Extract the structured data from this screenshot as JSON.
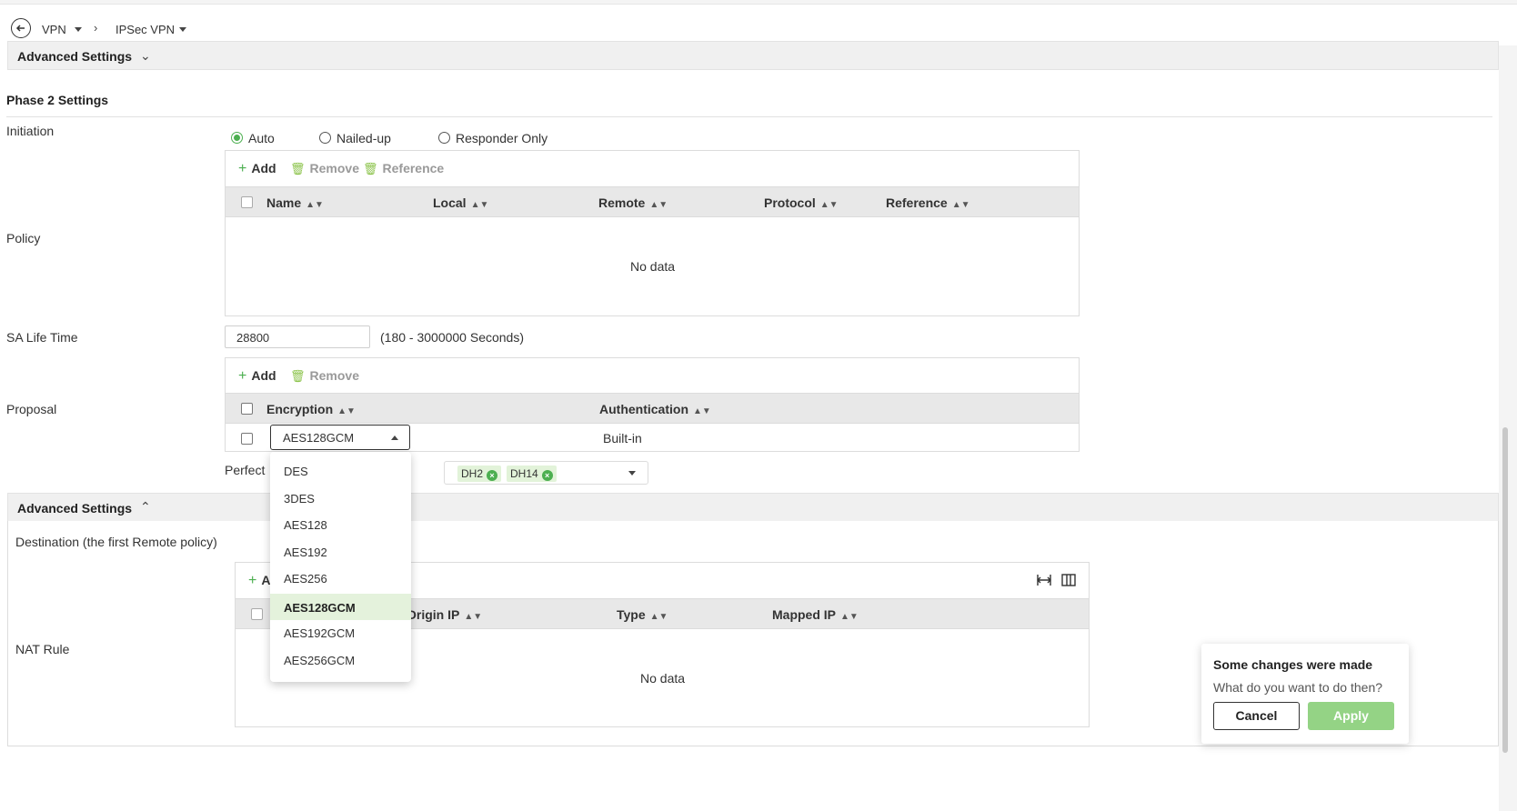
{
  "breadcrumb": {
    "item1": "VPN",
    "item2": "IPSec VPN"
  },
  "advanced_top": {
    "title": "Advanced Settings"
  },
  "phase2": {
    "title": "Phase 2 Settings",
    "initiation_label": "Initiation",
    "initiation_options": [
      "Auto",
      "Nailed-up",
      "Responder Only"
    ],
    "initiation_selected": "Auto",
    "policy_label": "Policy",
    "policy_toolbar": {
      "add": "Add",
      "remove": "Remove",
      "reference": "Reference"
    },
    "policy_columns": [
      "Name",
      "Local",
      "Remote",
      "Protocol",
      "Reference"
    ],
    "policy_empty": "No data",
    "sa_life_label": "SA Life Time",
    "sa_life_value": "28800",
    "sa_life_hint": "(180 - 3000000 Seconds)",
    "proposal_label": "Proposal",
    "proposal_toolbar": {
      "add": "Add",
      "remove": "Remove"
    },
    "proposal_columns": [
      "Encryption",
      "Authentication"
    ],
    "proposal_row": {
      "encryption": "AES128GCM",
      "authentication": "Built-in"
    },
    "pfs_label": "Perfect",
    "pfs_tags": [
      "DH2",
      "DH14"
    ]
  },
  "encryption_dropdown": {
    "options": [
      "DES",
      "3DES",
      "AES128",
      "AES192",
      "AES256",
      "AES128GCM",
      "AES192GCM",
      "AES256GCM"
    ],
    "selected": "AES128GCM"
  },
  "advanced_bottom": {
    "title": "Advanced Settings",
    "destination_label": "Destination (the first Remote policy)",
    "nat_label": "NAT Rule",
    "nat_add": "A",
    "nat_columns": [
      "Origin IP",
      "Type",
      "Mapped IP"
    ],
    "nat_empty": "No data"
  },
  "toast": {
    "title": "Some changes were made",
    "message": "What do you want to do then?",
    "cancel": "Cancel",
    "apply": "Apply"
  },
  "colors": {
    "accent": "#4caf50",
    "apply_disabled": "#94d385",
    "selected_bg": "#e4f2dc"
  }
}
